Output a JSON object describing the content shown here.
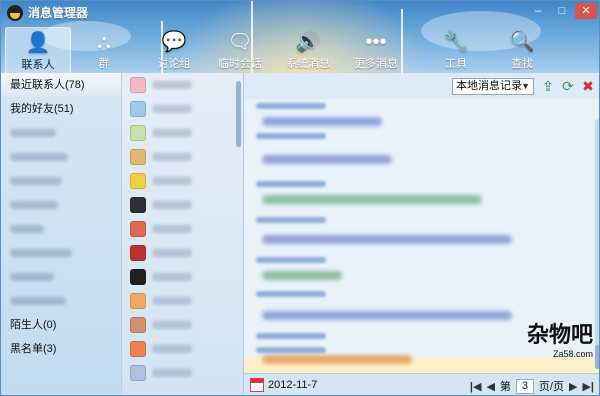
{
  "window": {
    "title": "消息管理器",
    "min": "–",
    "max": "□",
    "close": "✕"
  },
  "toolbar": [
    {
      "label": "联系人",
      "icon": "person-icon",
      "glyph": "👤",
      "active": true
    },
    {
      "label": "群",
      "icon": "group-icon",
      "glyph": "⛬",
      "active": false
    },
    {
      "label": "讨论组",
      "icon": "discussion-icon",
      "glyph": "💬",
      "active": false
    },
    {
      "label": "临时会话",
      "icon": "temp-chat-icon",
      "glyph": "🗨",
      "active": false
    },
    {
      "label": "系统消息",
      "icon": "speaker-icon",
      "glyph": "🔊",
      "active": false
    },
    {
      "label": "更多消息",
      "icon": "more-icon",
      "glyph": "•••",
      "active": false
    },
    {
      "label": "工具",
      "icon": "wrench-icon",
      "glyph": "🔧",
      "active": false
    },
    {
      "label": "查找",
      "icon": "search-icon",
      "glyph": "🔍",
      "active": false
    }
  ],
  "groups": {
    "recent": "最近联系人(78)",
    "friends": "我的好友(51)",
    "strangers": "陌生人(0)",
    "blacklist": "黑名单(3)"
  },
  "contacts": [
    {
      "color": "#f5b8c8"
    },
    {
      "color": "#9ec9e8"
    },
    {
      "color": "#c7e1a8"
    },
    {
      "color": "#e0b870"
    },
    {
      "color": "#f0d040"
    },
    {
      "color": "#303030"
    },
    {
      "color": "#e06850"
    },
    {
      "color": "#c03030"
    },
    {
      "color": "#202020"
    },
    {
      "color": "#f0a860"
    },
    {
      "color": "#d09070"
    },
    {
      "color": "#f08050"
    },
    {
      "color": "#b0c0e0"
    }
  ],
  "messages": {
    "source": "本地消息记录",
    "date": "2012-11-7",
    "page_prefix": "第",
    "page": "3",
    "page_suffix": "页/页"
  },
  "watermark": {
    "main": "杂物吧",
    "sub": "Za58.com"
  }
}
